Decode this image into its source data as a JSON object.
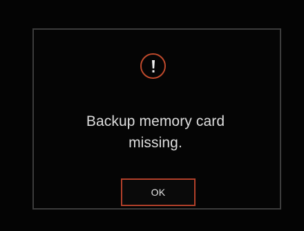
{
  "dialog": {
    "icon": "exclamation-alert-icon",
    "message_line1": "Backup memory card",
    "message_line2": "missing.",
    "ok_label": "OK"
  },
  "colors": {
    "background": "#050505",
    "border": "#3c3c3c",
    "accent": "#c04a2c",
    "text": "#dedede"
  }
}
